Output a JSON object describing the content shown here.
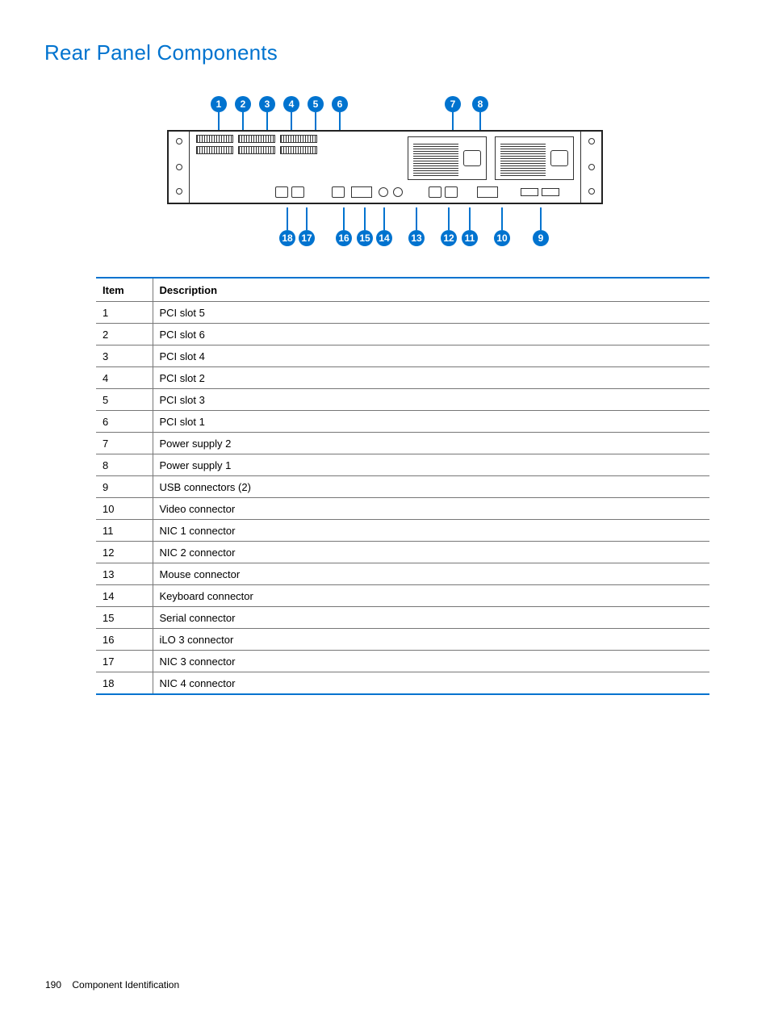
{
  "title": "Rear Panel Components",
  "table": {
    "headers": {
      "item": "Item",
      "description": "Description"
    },
    "rows": [
      {
        "item": "1",
        "description": "PCI slot 5"
      },
      {
        "item": "2",
        "description": "PCI slot 6"
      },
      {
        "item": "3",
        "description": "PCI slot 4"
      },
      {
        "item": "4",
        "description": "PCI slot 2"
      },
      {
        "item": "5",
        "description": "PCI slot 3"
      },
      {
        "item": "6",
        "description": "PCI slot 1"
      },
      {
        "item": "7",
        "description": "Power supply 2"
      },
      {
        "item": "8",
        "description": "Power supply 1"
      },
      {
        "item": "9",
        "description": "USB connectors (2)"
      },
      {
        "item": "10",
        "description": "Video connector"
      },
      {
        "item": "11",
        "description": "NIC 1 connector"
      },
      {
        "item": "12",
        "description": "NIC 2 connector"
      },
      {
        "item": "13",
        "description": "Mouse connector"
      },
      {
        "item": "14",
        "description": "Keyboard connector"
      },
      {
        "item": "15",
        "description": "Serial connector"
      },
      {
        "item": "16",
        "description": "iLO 3 connector"
      },
      {
        "item": "17",
        "description": "NIC 3 connector"
      },
      {
        "item": "18",
        "description": "NIC 4 connector"
      }
    ]
  },
  "callouts": {
    "top": [
      "1",
      "2",
      "3",
      "4",
      "5",
      "6",
      "7",
      "8"
    ],
    "bottom": [
      "18",
      "17",
      "16",
      "15",
      "14",
      "13",
      "12",
      "11",
      "10",
      "9"
    ]
  },
  "footer": {
    "page": "190",
    "section": "Component Identification"
  }
}
